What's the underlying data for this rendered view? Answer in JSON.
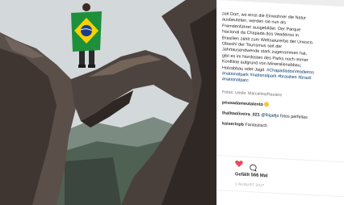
{
  "post": {
    "caption_lines": [
      "zeit Dort, wo einst die Einwohner die Natur",
      "ausbeuteten, werden sie nun als",
      "Fremdenführer ausgebildet. Der Parque",
      "Nacional da Chapada dos Veadeiros in",
      "Brasilien zählt zum Weltnaturerbe der Unesco.",
      "Obwohl der Tourismus seit der",
      "Jahrtausendwende stark zugenommen hat,",
      "gibt es im Nordosten des Parks noch immer",
      "Konflikte aufgrund von Mineralienabbau,",
      "Holzabbau oder Jagd. "
    ],
    "hashtags_inline": "#ChapadadosVeadeiros",
    "hashtags_line2": "#nationalpark #nationalpark #brasilien #brazil",
    "hashtags_line3": "#nationalparc",
    "credit": "Fotos: Uesle: Marcelino/Reuters",
    "comments": [
      {
        "user": "pousadameutalento",
        "text": ""
      },
      {
        "user": "thalitaoliveira_021",
        "mention": "@filipefjo",
        "text": " fotos perfeitas"
      },
      {
        "user": "kaiserinpb",
        "text": " Fantastisch"
      }
    ],
    "likes": "Gefällt 566 Mal",
    "date": "1 AUGUST 2017"
  },
  "colors": {
    "hashtag": "#003569",
    "heart": "#ed4956",
    "text": "#262626"
  },
  "icons": [
    "heart-icon",
    "comment-bubble-icon",
    "brazil-flag"
  ]
}
